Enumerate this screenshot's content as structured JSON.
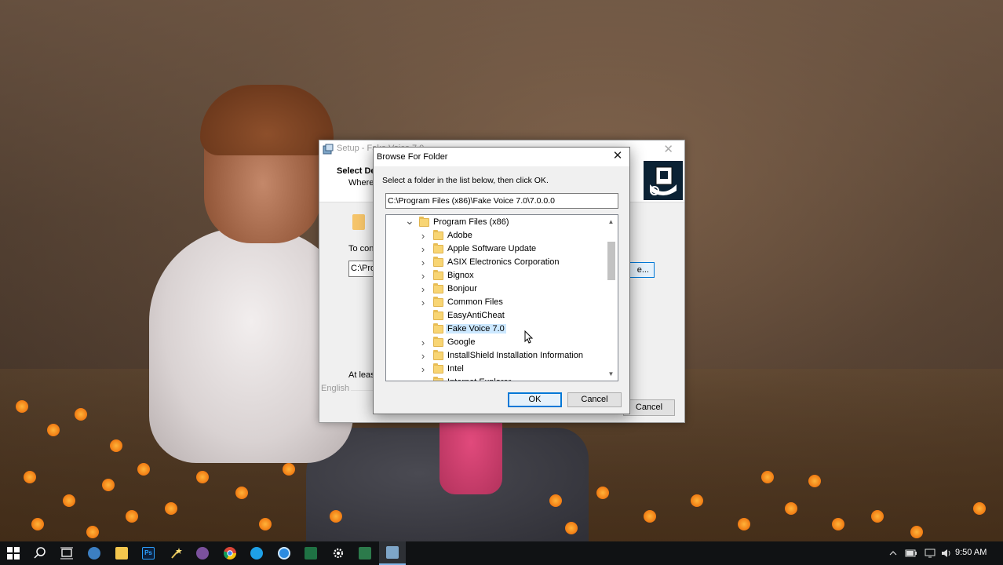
{
  "setup_window": {
    "title": "Setup - Fake Voice 7.0",
    "header_title": "Select De",
    "header_subtitle": "Where",
    "to_continue": "To con",
    "path_value": "C:\\Prog",
    "browse_label": "e...",
    "at_least": "At leas",
    "language": "English",
    "cancel_label": "Cancel"
  },
  "dialog": {
    "title": "Browse For Folder",
    "close_glyph": "✕",
    "instruction": "Select a folder in the list below, then click OK.",
    "path_value": "C:\\Program Files (x86)\\Fake Voice 7.0\\7.0.0.0",
    "tree_items": [
      {
        "label": "Program Files (x86)",
        "expanded": true,
        "has_children": true
      },
      {
        "label": "Adobe",
        "has_children": true
      },
      {
        "label": "Apple Software Update",
        "has_children": true
      },
      {
        "label": "ASIX Electronics Corporation",
        "has_children": true
      },
      {
        "label": "Bignox",
        "has_children": true
      },
      {
        "label": "Bonjour",
        "has_children": true
      },
      {
        "label": "Common Files",
        "has_children": true
      },
      {
        "label": "EasyAntiCheat",
        "has_children": false
      },
      {
        "label": "Fake Voice 7.0",
        "has_children": false,
        "selected": true
      },
      {
        "label": "Google",
        "has_children": true
      },
      {
        "label": "InstallShield Installation Information",
        "has_children": true
      },
      {
        "label": "Intel",
        "has_children": true
      },
      {
        "label": "Internet Explorer",
        "has_children": true
      }
    ],
    "ok_label": "OK",
    "cancel_label": "Cancel"
  },
  "taskbar": {
    "clock": "9:50 AM",
    "icons": [
      "windows-start-icon",
      "search-icon",
      "task-view-icon",
      "edge-icon",
      "file-explorer-icon",
      "photoshop-icon",
      "wand-icon",
      "viber-icon",
      "chrome-icon",
      "browser-icon",
      "browser-alt-icon",
      "excel-icon",
      "settings-icon",
      "spreadsheet-icon",
      "setup-icon"
    ],
    "photoshop_label": "Ps"
  },
  "colors": {
    "accent": "#0078d7",
    "selection": "#cce8ff",
    "taskbar": "#101214"
  }
}
